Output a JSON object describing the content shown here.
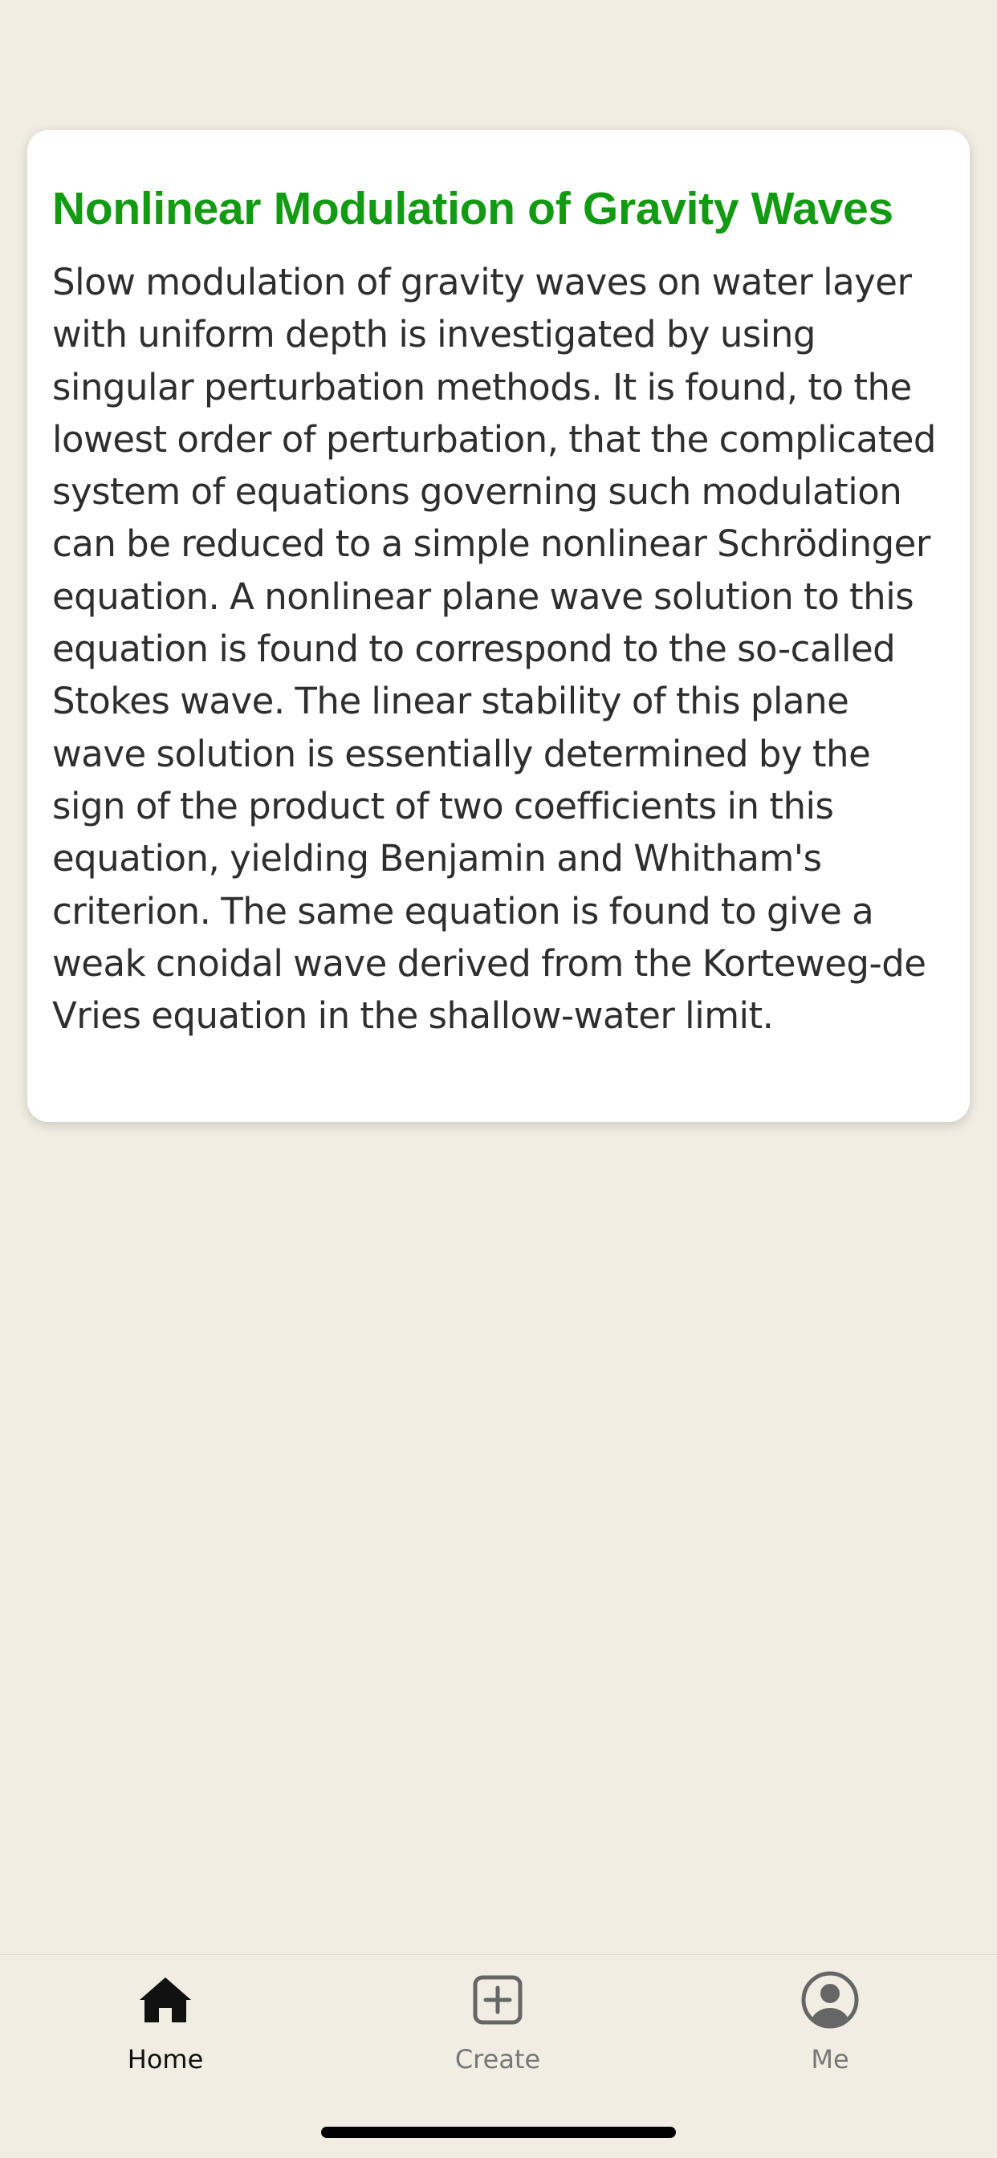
{
  "article": {
    "title": "Nonlinear Modulation of Gravity Waves",
    "body": "Slow modulation of gravity waves on water layer with uniform depth is investigated by using singular perturbation methods. It is found, to the lowest order of perturbation, that the complicated system of equations governing such modulation can be reduced to a simple nonlinear Schrödinger equation. A nonlinear plane wave solution to this equation is found to correspond to the so-called Stokes wave. The linear stability of this plane wave solution is essentially determined by the sign of the product of two coefficients in this equation, yielding Benjamin and Whitham's criterion. The same equation is found to give a weak cnoidal wave derived from the Korteweg-de Vries equation in the shallow-water limit."
  },
  "tabbar": {
    "items": [
      {
        "label": "Home",
        "icon": "home-icon",
        "active": true
      },
      {
        "label": "Create",
        "icon": "plus-square-icon",
        "active": false
      },
      {
        "label": "Me",
        "icon": "user-circle-icon",
        "active": false
      }
    ]
  },
  "colors": {
    "background": "#f1ede3",
    "card": "#ffffff",
    "title": "#129a12",
    "body_text": "#2e2e2e",
    "tab_active": "#111111",
    "tab_inactive": "#777777"
  }
}
